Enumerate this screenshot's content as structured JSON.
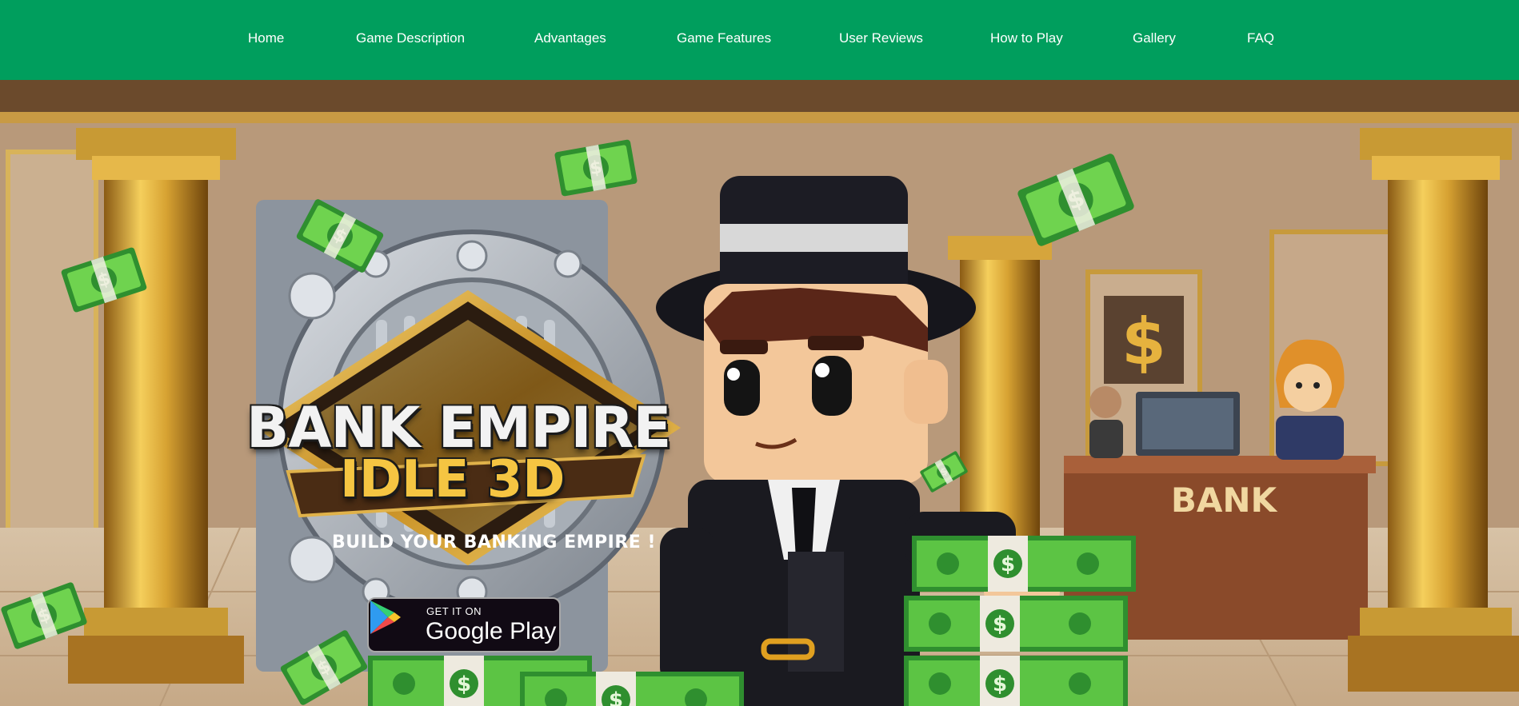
{
  "nav": {
    "items": [
      {
        "label": "Home"
      },
      {
        "label": "Game Description"
      },
      {
        "label": "Advantages"
      },
      {
        "label": "Game Features"
      },
      {
        "label": "User Reviews"
      },
      {
        "label": "How to Play"
      },
      {
        "label": "Gallery"
      },
      {
        "label": "FAQ"
      }
    ]
  },
  "hero": {
    "logo_title": "BANK EMPIRE",
    "logo_subtitle": "IDLE 3D",
    "tagline": "BUILD YOUR BANKING EMPIRE !",
    "desk_sign": "BANK",
    "google_play": {
      "small_text": "GET IT ON",
      "big_text": "Google Play"
    }
  },
  "colors": {
    "nav_bg": "#009e5d",
    "nav_text": "#ffffff",
    "gold": "#f5c542",
    "money_green": "#3cb43c",
    "badge_bg": "#110a14"
  }
}
